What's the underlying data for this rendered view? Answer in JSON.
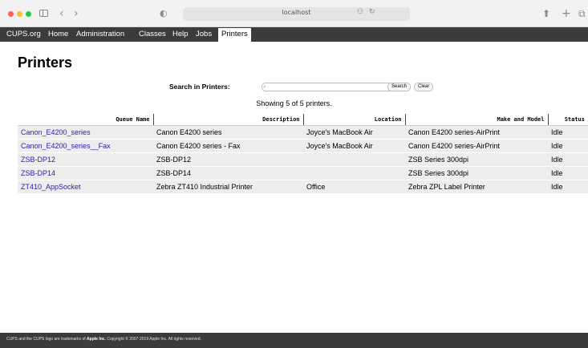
{
  "browser": {
    "url": "localhost"
  },
  "nav": {
    "items": [
      "CUPS.org",
      "Home",
      "Administration",
      "Classes",
      "Help",
      "Jobs",
      "Printers"
    ],
    "active": "Printers"
  },
  "page": {
    "title": "Printers"
  },
  "search": {
    "label": "Search in Printers:",
    "placeholder": "",
    "search_button": "Search",
    "clear_button": "Clear"
  },
  "summary": "Showing 5 of 5 printers.",
  "table": {
    "headers": [
      "Queue Name",
      "Description",
      "Location",
      "Make and Model",
      "Status"
    ],
    "rows": [
      {
        "queue": "Canon_E4200_series",
        "description": "Canon E4200 series",
        "location": "Joyce's MacBook Air",
        "model": "Canon E4200 series-AirPrint",
        "status": "Idle"
      },
      {
        "queue": "Canon_E4200_series__Fax",
        "description": "Canon E4200 series - Fax",
        "location": "Joyce's MacBook Air",
        "model": "Canon E4200 series-AirPrint",
        "status": "Idle"
      },
      {
        "queue": "ZSB-DP12",
        "description": "ZSB-DP12",
        "location": "",
        "model": "ZSB Series 300dpi",
        "status": "Idle"
      },
      {
        "queue": "ZSB-DP14",
        "description": "ZSB-DP14",
        "location": "",
        "model": "ZSB Series 300dpi",
        "status": "Idle"
      },
      {
        "queue": "ZT410_AppSocket",
        "description": "Zebra ZT410 Industrial Printer",
        "location": "Office",
        "model": "Zebra ZPL Label Printer",
        "status": "Idle"
      }
    ]
  },
  "footer": {
    "prefix": "CUPS and the CUPS logo are trademarks of ",
    "company": "Apple Inc.",
    "suffix": " Copyright © 2007-2019 Apple Inc. All rights reserved."
  },
  "colors": {
    "navbar_bg": "#3b3b3b",
    "link": "#2a1fa8",
    "row_bg": "#ededed"
  }
}
